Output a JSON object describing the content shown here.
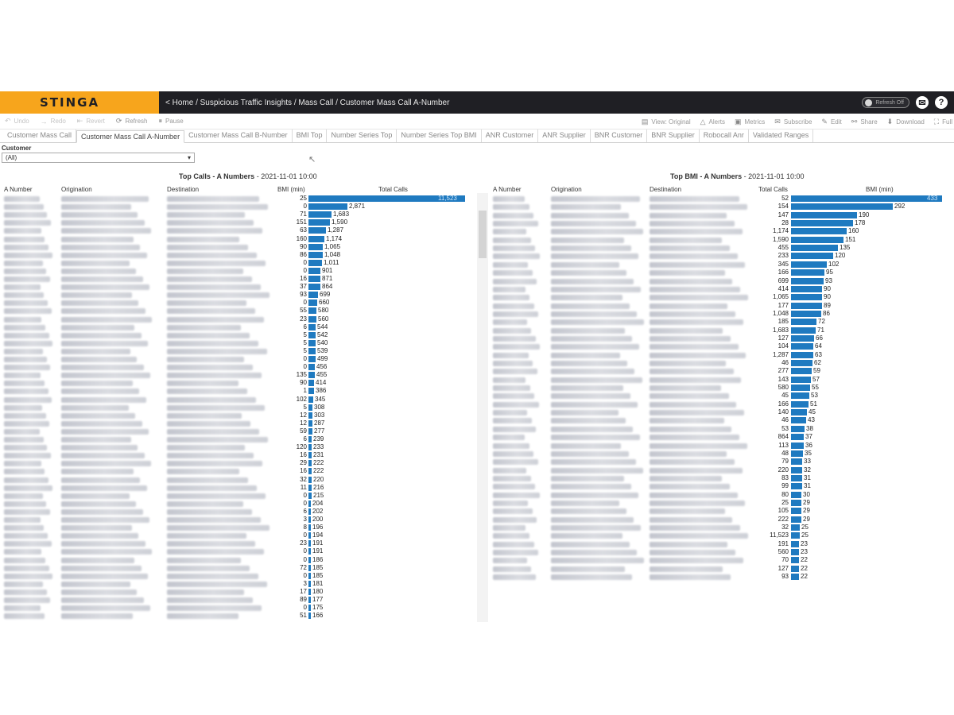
{
  "app": {
    "logo": "STINGA",
    "breadcrumb": "< Home / Suspicious Traffic Insights / Mass Call / Customer Mass Call A-Number",
    "refresh_toggle": "Refresh Off",
    "icons": {
      "mail": "mail-icon",
      "help": "help-icon"
    }
  },
  "toolbar": {
    "undo": "Undo",
    "redo": "Redo",
    "revert": "Revert",
    "refresh": "Refresh",
    "pause": "Pause",
    "view_original": "View: Original",
    "alerts": "Alerts",
    "metrics": "Metrics",
    "subscribe": "Subscribe",
    "edit": "Edit",
    "share": "Share",
    "download": "Download",
    "full": "Full"
  },
  "tabs": [
    {
      "label": "Customer Mass Call",
      "active": false
    },
    {
      "label": "Customer Mass Call A-Number",
      "active": true
    },
    {
      "label": "Customer Mass Call B-Number",
      "active": false
    },
    {
      "label": "BMI Top",
      "active": false
    },
    {
      "label": "Number Series Top",
      "active": false
    },
    {
      "label": "Number Series Top BMI",
      "active": false
    },
    {
      "label": "ANR Customer",
      "active": false
    },
    {
      "label": "ANR Supplier",
      "active": false
    },
    {
      "label": "BNR Customer",
      "active": false
    },
    {
      "label": "BNR Supplier",
      "active": false
    },
    {
      "label": "Robocall Anr",
      "active": false
    },
    {
      "label": "Validated Ranges",
      "active": false
    }
  ],
  "filter": {
    "label": "Customer",
    "value": "(All)"
  },
  "left_panel": {
    "title": "Top Calls - A Numbers",
    "timestamp": "2021-11-01 10:00",
    "headers": {
      "a_number": "A Number",
      "origination": "Origination",
      "destination": "Destination",
      "metric": "BMI (min)",
      "bar": "Total Calls"
    },
    "bar_max": 11523,
    "rows": [
      {
        "m": "25",
        "v": 11523
      },
      {
        "m": "0",
        "v": 2871
      },
      {
        "m": "71",
        "v": 1683
      },
      {
        "m": "151",
        "v": 1590
      },
      {
        "m": "63",
        "v": 1287
      },
      {
        "m": "160",
        "v": 1174
      },
      {
        "m": "90",
        "v": 1065
      },
      {
        "m": "86",
        "v": 1048
      },
      {
        "m": "0",
        "v": 1011
      },
      {
        "m": "0",
        "v": 901
      },
      {
        "m": "16",
        "v": 871
      },
      {
        "m": "37",
        "v": 864
      },
      {
        "m": "93",
        "v": 699
      },
      {
        "m": "0",
        "v": 660
      },
      {
        "m": "55",
        "v": 580
      },
      {
        "m": "23",
        "v": 560
      },
      {
        "m": "6",
        "v": 544
      },
      {
        "m": "5",
        "v": 542
      },
      {
        "m": "5",
        "v": 540
      },
      {
        "m": "5",
        "v": 539
      },
      {
        "m": "0",
        "v": 499
      },
      {
        "m": "0",
        "v": 456
      },
      {
        "m": "135",
        "v": 455
      },
      {
        "m": "90",
        "v": 414
      },
      {
        "m": "1",
        "v": 386
      },
      {
        "m": "102",
        "v": 345
      },
      {
        "m": "5",
        "v": 308
      },
      {
        "m": "12",
        "v": 303
      },
      {
        "m": "12",
        "v": 287
      },
      {
        "m": "59",
        "v": 277
      },
      {
        "m": "6",
        "v": 239
      },
      {
        "m": "120",
        "v": 233
      },
      {
        "m": "16",
        "v": 231
      },
      {
        "m": "29",
        "v": 222
      },
      {
        "m": "16",
        "v": 222
      },
      {
        "m": "32",
        "v": 220
      },
      {
        "m": "11",
        "v": 216
      },
      {
        "m": "0",
        "v": 215
      },
      {
        "m": "0",
        "v": 204
      },
      {
        "m": "6",
        "v": 202
      },
      {
        "m": "3",
        "v": 200
      },
      {
        "m": "8",
        "v": 196
      },
      {
        "m": "0",
        "v": 194
      },
      {
        "m": "23",
        "v": 191
      },
      {
        "m": "0",
        "v": 191
      },
      {
        "m": "0",
        "v": 186
      },
      {
        "m": "72",
        "v": 185
      },
      {
        "m": "0",
        "v": 185
      },
      {
        "m": "3",
        "v": 181
      },
      {
        "m": "17",
        "v": 180
      },
      {
        "m": "89",
        "v": 177
      },
      {
        "m": "0",
        "v": 175
      },
      {
        "m": "51",
        "v": 166
      }
    ]
  },
  "right_panel": {
    "title": "Top BMI - A Numbers",
    "timestamp": "2021-11-01 10:00",
    "headers": {
      "a_number": "A Number",
      "origination": "Origination",
      "destination": "Destination",
      "metric": "Total Calls",
      "bar": "BMI (min)"
    },
    "bar_max": 433,
    "rows": [
      {
        "m": "52",
        "v": 433
      },
      {
        "m": "154",
        "v": 292
      },
      {
        "m": "147",
        "v": 190
      },
      {
        "m": "28",
        "v": 178
      },
      {
        "m": "1,174",
        "v": 160
      },
      {
        "m": "1,590",
        "v": 151
      },
      {
        "m": "455",
        "v": 135
      },
      {
        "m": "233",
        "v": 120
      },
      {
        "m": "345",
        "v": 102
      },
      {
        "m": "166",
        "v": 95
      },
      {
        "m": "699",
        "v": 93
      },
      {
        "m": "414",
        "v": 90
      },
      {
        "m": "1,065",
        "v": 90
      },
      {
        "m": "177",
        "v": 89
      },
      {
        "m": "1,048",
        "v": 86
      },
      {
        "m": "185",
        "v": 72
      },
      {
        "m": "1,683",
        "v": 71
      },
      {
        "m": "127",
        "v": 66
      },
      {
        "m": "104",
        "v": 64
      },
      {
        "m": "1,287",
        "v": 63
      },
      {
        "m": "46",
        "v": 62
      },
      {
        "m": "277",
        "v": 59
      },
      {
        "m": "143",
        "v": 57
      },
      {
        "m": "580",
        "v": 55
      },
      {
        "m": "45",
        "v": 53
      },
      {
        "m": "166",
        "v": 51
      },
      {
        "m": "140",
        "v": 45
      },
      {
        "m": "46",
        "v": 43
      },
      {
        "m": "53",
        "v": 38
      },
      {
        "m": "864",
        "v": 37
      },
      {
        "m": "113",
        "v": 36
      },
      {
        "m": "48",
        "v": 35
      },
      {
        "m": "79",
        "v": 33
      },
      {
        "m": "220",
        "v": 32
      },
      {
        "m": "83",
        "v": 31
      },
      {
        "m": "99",
        "v": 31
      },
      {
        "m": "80",
        "v": 30
      },
      {
        "m": "25",
        "v": 29
      },
      {
        "m": "105",
        "v": 29
      },
      {
        "m": "222",
        "v": 29
      },
      {
        "m": "32",
        "v": 25
      },
      {
        "m": "11,523",
        "v": 25
      },
      {
        "m": "191",
        "v": 23
      },
      {
        "m": "560",
        "v": 23
      },
      {
        "m": "70",
        "v": 22
      },
      {
        "m": "127",
        "v": 22
      },
      {
        "m": "93",
        "v": 22
      }
    ]
  },
  "colors": {
    "logo_bg": "#f7a51c",
    "header_bg": "#1f1f24",
    "bar": "#1f7ac0"
  }
}
